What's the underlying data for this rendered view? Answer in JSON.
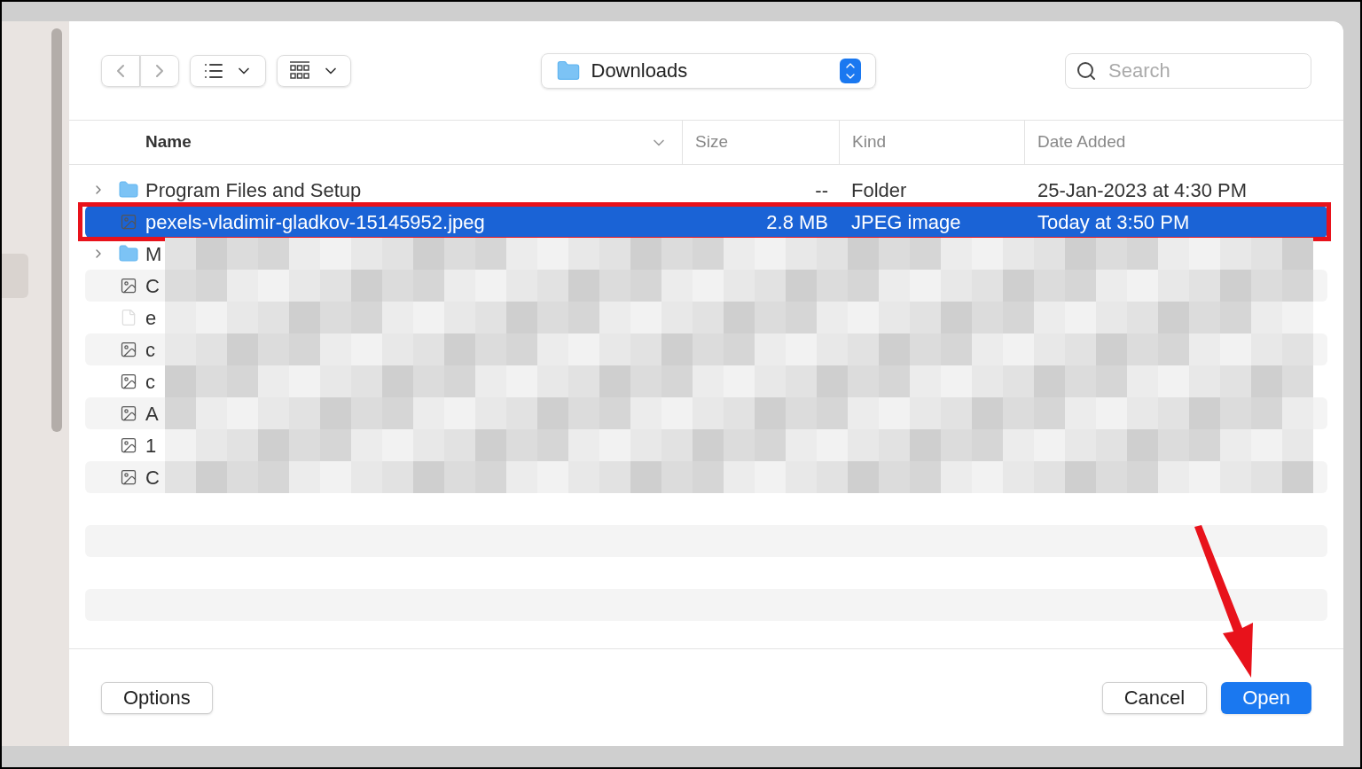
{
  "toolbar": {
    "location": "Downloads",
    "search": {
      "placeholder": "Search"
    }
  },
  "table": {
    "columns": [
      {
        "label": "Name",
        "sorted": true
      },
      {
        "label": "Size",
        "sorted": false
      },
      {
        "label": "Kind",
        "sorted": false
      },
      {
        "label": "Date Added",
        "sorted": false
      }
    ],
    "rows": [
      {
        "kind": "folder",
        "name": "Program Files and Setup",
        "size": "--",
        "type": "Folder",
        "date": "25-Jan-2023 at 4:30 PM",
        "selected": false,
        "redacted": false
      },
      {
        "kind": "image",
        "name": "pexels-vladimir-gladkov-15145952.jpeg",
        "size": "2.8 MB",
        "type": "JPEG image",
        "date": "Today at 3:50 PM",
        "selected": true,
        "redacted": false
      },
      {
        "kind": "folder",
        "name": "M",
        "selected": false,
        "redacted": true
      },
      {
        "kind": "image",
        "name": "C",
        "selected": false,
        "redacted": true
      },
      {
        "kind": "file",
        "name": "e",
        "selected": false,
        "redacted": true
      },
      {
        "kind": "image",
        "name": "c",
        "selected": false,
        "redacted": true
      },
      {
        "kind": "image",
        "name": "c",
        "selected": false,
        "redacted": true
      },
      {
        "kind": "image",
        "name": "A",
        "selected": false,
        "redacted": true
      },
      {
        "kind": "image",
        "name": "1",
        "selected": false,
        "redacted": true
      },
      {
        "kind": "image",
        "name": "C",
        "selected": false,
        "redacted": true
      }
    ]
  },
  "buttons": [
    {
      "kind": "options",
      "label": "Options"
    },
    {
      "kind": "cancel",
      "label": "Cancel"
    },
    {
      "kind": "default",
      "label": "Open"
    }
  ]
}
